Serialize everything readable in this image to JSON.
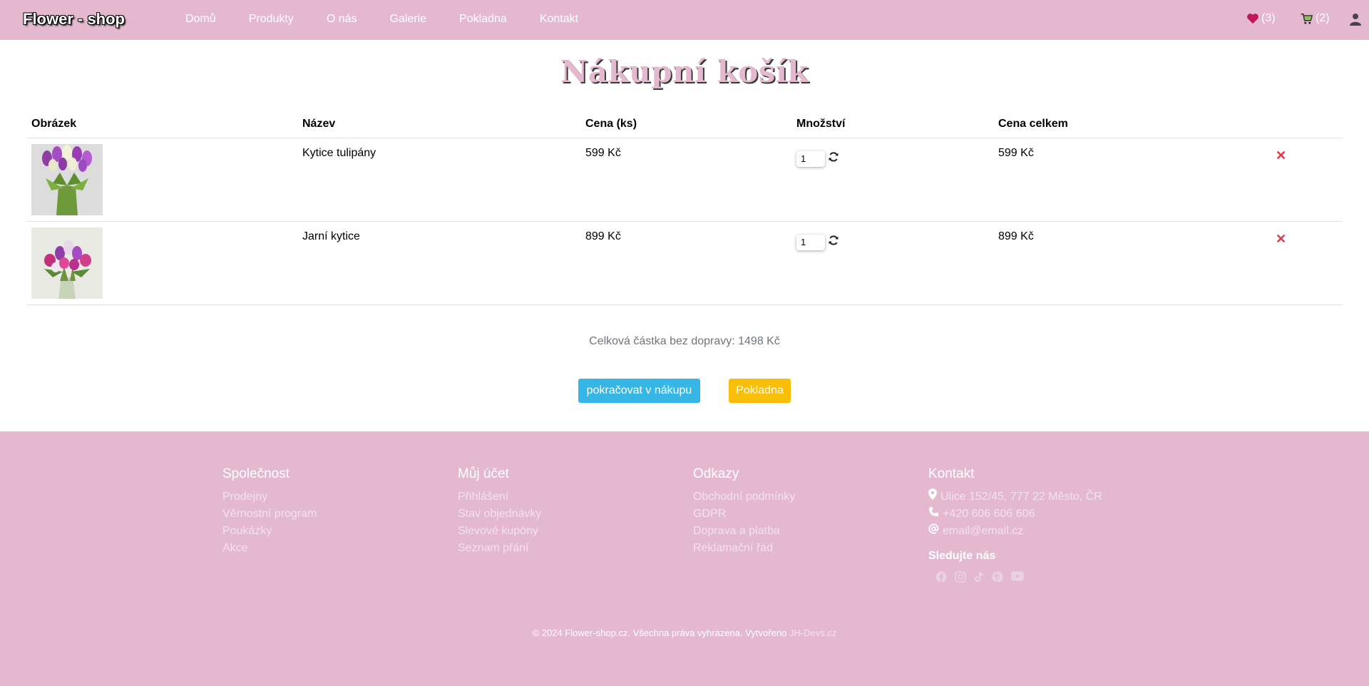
{
  "navbar": {
    "brand": "Flower - shop",
    "links": [
      "Domů",
      "Produkty",
      "O nás",
      "Galerie",
      "Pokladna",
      "Kontakt"
    ],
    "wishlist_count": "(3)",
    "cart_count": "(2)",
    "icons": {
      "wishlist": "heart-icon",
      "cart": "cart-icon",
      "user": "user-icon"
    },
    "colors": {
      "background": "#e4b9cf",
      "wishlist_icon": "#c2185b",
      "cart_icon": "#8bc34a"
    }
  },
  "page": {
    "title": "Nákupní košík"
  },
  "table": {
    "headers": [
      "Obrázek",
      "Název",
      "Cena (ks)",
      "Množství",
      "Cena celkem"
    ],
    "rows": [
      {
        "image": "tulip-bouquet-purple-white",
        "name": "Kytice tulipány",
        "price": "599 Kč",
        "quantity": "1",
        "total": "599 Kč"
      },
      {
        "image": "spring-bouquet-pink",
        "name": "Jarní kytice",
        "price": "899 Kč",
        "quantity": "1",
        "total": "899 Kč"
      }
    ],
    "remove_symbol": "✕",
    "icons": {
      "refresh": "refresh-icon",
      "remove": "close-icon"
    }
  },
  "summary": {
    "total_text": "Celková částka bez dopravy: 1498 Kč",
    "continue_label": "pokračovat v nákupu",
    "checkout_label": "Pokladna",
    "colors": {
      "continue": "#35b6e6",
      "checkout": "#f9be08"
    }
  },
  "footer": {
    "columns": [
      {
        "title": "Společnost",
        "links": [
          "Prodejny",
          "Věrnostní program",
          "Poukázky",
          "Akce"
        ]
      },
      {
        "title": "Můj účet",
        "links": [
          "Přihlášení",
          "Stav objednávky",
          "Slevové kupóny",
          "Seznam přání"
        ]
      },
      {
        "title": "Odkazy",
        "links": [
          "Obchodní podmínky",
          "GDPR",
          "Doprava a platba",
          "Reklamační řád"
        ]
      }
    ],
    "contact": {
      "title": "Kontakt",
      "address": "Ulice 152/45, 777 22 Město, ČR",
      "phone": "+420 606 606 606",
      "email": "email@email.cz",
      "follow_title": "Sledujte nás",
      "socials": [
        "facebook-icon",
        "instagram-icon",
        "tiktok-icon",
        "pinterest-icon",
        "youtube-icon"
      ]
    },
    "copyright": "© 2024 Flower-shop.cz. Všechna práva vyhrazena. Vytvořeno",
    "developer": "JH-Devs.cz"
  }
}
